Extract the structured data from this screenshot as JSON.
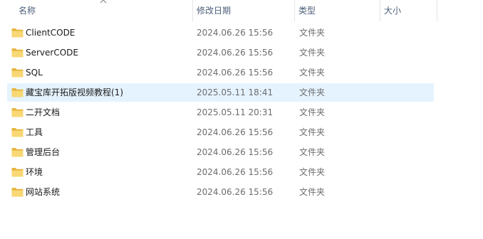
{
  "columns": {
    "name": "名称",
    "date": "修改日期",
    "type": "类型",
    "size": "大小"
  },
  "sort": {
    "column": "name",
    "direction": "ascending"
  },
  "colors": {
    "selection": "#e5f3ff",
    "folder": "#f8d775",
    "header_text": "#4c607a"
  },
  "files": [
    {
      "name": "ClientCODE",
      "date": "2024.06.26 15:56",
      "type": "文件夹",
      "size": "",
      "icon": "folder-icon",
      "selected": false
    },
    {
      "name": "ServerCODE",
      "date": "2024.06.26 15:56",
      "type": "文件夹",
      "size": "",
      "icon": "folder-icon",
      "selected": false
    },
    {
      "name": "SQL",
      "date": "2024.06.26 15:56",
      "type": "文件夹",
      "size": "",
      "icon": "folder-icon",
      "selected": false
    },
    {
      "name": "藏宝库开拓版视频教程(1)",
      "date": "2025.05.11 18:41",
      "type": "文件夹",
      "size": "",
      "icon": "folder-icon",
      "selected": true
    },
    {
      "name": "二开文档",
      "date": "2025.05.11 20:31",
      "type": "文件夹",
      "size": "",
      "icon": "folder-icon",
      "selected": false
    },
    {
      "name": "工具",
      "date": "2024.06.26 15:56",
      "type": "文件夹",
      "size": "",
      "icon": "folder-icon",
      "selected": false
    },
    {
      "name": "管理后台",
      "date": "2024.06.26 15:56",
      "type": "文件夹",
      "size": "",
      "icon": "folder-icon",
      "selected": false
    },
    {
      "name": "环境",
      "date": "2024.06.26 15:56",
      "type": "文件夹",
      "size": "",
      "icon": "folder-icon",
      "selected": false
    },
    {
      "name": "网站系统",
      "date": "2024.06.26 15:56",
      "type": "文件夹",
      "size": "",
      "icon": "folder-icon",
      "selected": false
    }
  ]
}
